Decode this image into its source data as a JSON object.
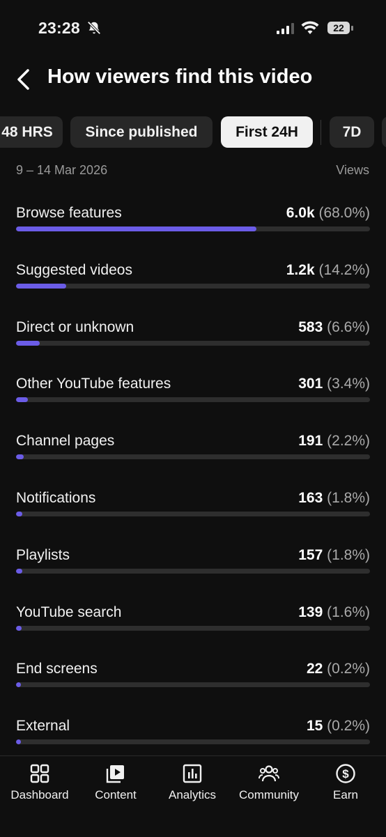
{
  "status_bar": {
    "time": "23:28",
    "battery": "22"
  },
  "header": {
    "title": "How viewers find this video"
  },
  "chips": [
    {
      "label": "48 HRS",
      "active": false
    },
    {
      "label": "Since published",
      "active": false
    },
    {
      "label": "First 24H",
      "active": true
    },
    {
      "label": "7D",
      "active": false
    }
  ],
  "date_range": "9 – 14 Mar 2026",
  "metric_label": "Views",
  "accent_color": "#6b5ce7",
  "sources": [
    {
      "name": "Browse features",
      "value": "6.0k",
      "percent": "(68.0%)",
      "share": 0.68
    },
    {
      "name": "Suggested videos",
      "value": "1.2k",
      "percent": "(14.2%)",
      "share": 0.142
    },
    {
      "name": "Direct or unknown",
      "value": "583",
      "percent": "(6.6%)",
      "share": 0.066
    },
    {
      "name": "Other YouTube features",
      "value": "301",
      "percent": "(3.4%)",
      "share": 0.034
    },
    {
      "name": "Channel pages",
      "value": "191",
      "percent": "(2.2%)",
      "share": 0.022
    },
    {
      "name": "Notifications",
      "value": "163",
      "percent": "(1.8%)",
      "share": 0.018
    },
    {
      "name": "Playlists",
      "value": "157",
      "percent": "(1.8%)",
      "share": 0.018
    },
    {
      "name": "YouTube search",
      "value": "139",
      "percent": "(1.6%)",
      "share": 0.016
    },
    {
      "name": "End screens",
      "value": "22",
      "percent": "(0.2%)",
      "share": 0.002
    },
    {
      "name": "External",
      "value": "15",
      "percent": "(0.2%)",
      "share": 0.002
    }
  ],
  "nav": [
    {
      "label": "Dashboard",
      "icon": "dashboard-icon"
    },
    {
      "label": "Content",
      "icon": "content-icon"
    },
    {
      "label": "Analytics",
      "icon": "analytics-icon"
    },
    {
      "label": "Community",
      "icon": "community-icon"
    },
    {
      "label": "Earn",
      "icon": "earn-icon"
    }
  ]
}
